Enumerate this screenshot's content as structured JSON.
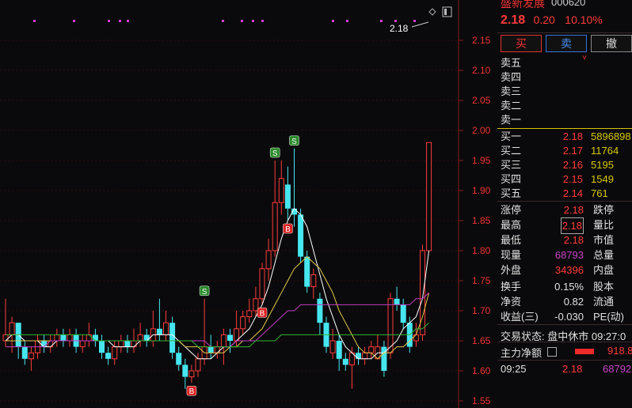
{
  "quote": {
    "name": "盛新发展",
    "code": "000620",
    "last_price": "2.18",
    "change": "0.20",
    "change_pct": "10.10%"
  },
  "actions": {
    "buy": "买",
    "sell": "卖",
    "cancel": "撤"
  },
  "order_book": {
    "asks": [
      {
        "label": "卖五"
      },
      {
        "label": "卖四"
      },
      {
        "label": "卖三"
      },
      {
        "label": "卖二"
      },
      {
        "label": "卖一"
      }
    ],
    "bids": [
      {
        "label": "买一",
        "price": "2.18",
        "volume": "5896898"
      },
      {
        "label": "买二",
        "price": "2.17",
        "volume": "11764"
      },
      {
        "label": "买三",
        "price": "2.16",
        "volume": "5195"
      },
      {
        "label": "买四",
        "price": "2.15",
        "volume": "1549"
      },
      {
        "label": "买五",
        "price": "2.14",
        "volume": "761"
      }
    ]
  },
  "stats": [
    {
      "l1": "涨停",
      "v1": "2.18",
      "l2": "跌停",
      "c": "#ff3b3b",
      "boxed": false
    },
    {
      "l1": "最高",
      "v1": "2.18",
      "l2": "量比",
      "c": "#ff3b3b",
      "boxed": true
    },
    {
      "l1": "最低",
      "v1": "2.18",
      "l2": "市值",
      "c": "#ff3b3b",
      "boxed": false
    },
    {
      "l1": "现量",
      "v1": "68793",
      "l2": "总量",
      "c": "#c844c8",
      "boxed": false
    },
    {
      "l1": "外盘",
      "v1": "34396",
      "l2": "内盘",
      "c": "#ff3b3b",
      "boxed": false
    },
    {
      "l1": "换手",
      "v1": "0.15%",
      "l2": "股本",
      "c": "#e0e0e0",
      "boxed": false
    },
    {
      "l1": "净资",
      "v1": "0.82",
      "l2": "流通",
      "c": "#e0e0e0",
      "boxed": false
    },
    {
      "l1": "收益(三)",
      "v1": "-0.030",
      "l2": "PE(动)",
      "c": "#e0e0e0",
      "boxed": false
    }
  ],
  "trade_status": "交易状态: 盘中休市 09:27:0",
  "main_flow": {
    "label": "主力净额",
    "value": "918.8"
  },
  "ticks": [
    {
      "time": "09:25",
      "price": "2.18",
      "volume": "68792"
    }
  ],
  "colors": {
    "up": "#ff3b3b",
    "down": "#46e6f0",
    "ma1": "#ffffff",
    "ma2": "#e3c84a",
    "ma3": "#c23cc2",
    "ma4": "#32b432",
    "accent": "#d7c400"
  },
  "chart_data": {
    "type": "candlestick",
    "ylim": [
      1.55,
      2.2
    ],
    "y_ticks": [
      "2.15",
      "2.10",
      "2.05",
      "2.00",
      "1.95",
      "1.90",
      "1.85",
      "1.80",
      "1.75",
      "1.70",
      "1.65",
      "1.60",
      "1.55"
    ],
    "price_marker": "2.18",
    "candles": [
      [
        1.65,
        1.66,
        1.72,
        1.64
      ],
      [
        1.66,
        1.68,
        1.69,
        1.63
      ],
      [
        1.68,
        1.64,
        1.68,
        1.62
      ],
      [
        1.64,
        1.62,
        1.65,
        1.61
      ],
      [
        1.62,
        1.63,
        1.64,
        1.6
      ],
      [
        1.63,
        1.65,
        1.66,
        1.62
      ],
      [
        1.65,
        1.64,
        1.66,
        1.63
      ],
      [
        1.64,
        1.65,
        1.66,
        1.63
      ],
      [
        1.65,
        1.66,
        1.67,
        1.64
      ],
      [
        1.66,
        1.65,
        1.67,
        1.64
      ],
      [
        1.65,
        1.66,
        1.67,
        1.64
      ],
      [
        1.66,
        1.64,
        1.67,
        1.63
      ],
      [
        1.64,
        1.65,
        1.66,
        1.63
      ],
      [
        1.65,
        1.66,
        1.68,
        1.64
      ],
      [
        1.66,
        1.65,
        1.67,
        1.64
      ],
      [
        1.65,
        1.63,
        1.66,
        1.62
      ],
      [
        1.63,
        1.62,
        1.64,
        1.61
      ],
      [
        1.62,
        1.64,
        1.65,
        1.61
      ],
      [
        1.64,
        1.65,
        1.66,
        1.63
      ],
      [
        1.65,
        1.64,
        1.66,
        1.63
      ],
      [
        1.64,
        1.65,
        1.67,
        1.63
      ],
      [
        1.65,
        1.66,
        1.68,
        1.64
      ],
      [
        1.66,
        1.65,
        1.67,
        1.64
      ],
      [
        1.65,
        1.67,
        1.7,
        1.64
      ],
      [
        1.67,
        1.66,
        1.72,
        1.65
      ],
      [
        1.66,
        1.68,
        1.7,
        1.65
      ],
      [
        1.68,
        1.63,
        1.69,
        1.62
      ],
      [
        1.63,
        1.61,
        1.64,
        1.6
      ],
      [
        1.61,
        1.59,
        1.62,
        1.57
      ],
      [
        1.59,
        1.6,
        1.61,
        1.58
      ],
      [
        1.6,
        1.62,
        1.63,
        1.59
      ],
      [
        1.62,
        1.64,
        1.72,
        1.61
      ],
      [
        1.64,
        1.63,
        1.66,
        1.62
      ],
      [
        1.63,
        1.64,
        1.65,
        1.62
      ],
      [
        1.64,
        1.66,
        1.67,
        1.61
      ],
      [
        1.66,
        1.65,
        1.67,
        1.63
      ],
      [
        1.65,
        1.67,
        1.7,
        1.64
      ],
      [
        1.67,
        1.69,
        1.7,
        1.66
      ],
      [
        1.69,
        1.7,
        1.72,
        1.68
      ],
      [
        1.7,
        1.72,
        1.74,
        1.69
      ],
      [
        1.72,
        1.77,
        1.78,
        1.71
      ],
      [
        1.77,
        1.8,
        1.82,
        1.75
      ],
      [
        1.8,
        1.88,
        1.95,
        1.79
      ],
      [
        1.88,
        1.92,
        1.95,
        1.86
      ],
      [
        1.91,
        1.87,
        1.94,
        1.85
      ],
      [
        1.87,
        1.86,
        1.97,
        1.84
      ],
      [
        1.86,
        1.79,
        1.87,
        1.78
      ],
      [
        1.79,
        1.74,
        1.8,
        1.73
      ],
      [
        1.74,
        1.76,
        1.77,
        1.72
      ],
      [
        1.72,
        1.68,
        1.73,
        1.66
      ],
      [
        1.68,
        1.64,
        1.69,
        1.63
      ],
      [
        1.63,
        1.65,
        1.67,
        1.62
      ],
      [
        1.65,
        1.62,
        1.66,
        1.6
      ],
      [
        1.62,
        1.61,
        1.63,
        1.6
      ],
      [
        1.61,
        1.63,
        1.64,
        1.57
      ],
      [
        1.63,
        1.62,
        1.64,
        1.61
      ],
      [
        1.62,
        1.63,
        1.64,
        1.61
      ],
      [
        1.63,
        1.64,
        1.65,
        1.62
      ],
      [
        1.62,
        1.64,
        1.66,
        1.62
      ],
      [
        1.64,
        1.6,
        1.65,
        1.59
      ],
      [
        1.63,
        1.72,
        1.73,
        1.62
      ],
      [
        1.72,
        1.71,
        1.74,
        1.7
      ],
      [
        1.71,
        1.68,
        1.72,
        1.67
      ],
      [
        1.68,
        1.64,
        1.69,
        1.63
      ],
      [
        1.65,
        1.66,
        1.68,
        1.64
      ],
      [
        1.66,
        1.8,
        1.81,
        1.65
      ],
      [
        1.8,
        1.98,
        1.98,
        1.8
      ]
    ],
    "ma_lines": [
      {
        "name": "MA5",
        "color": "#ffffff",
        "values": [
          1.65,
          1.66,
          1.66,
          1.65,
          1.65,
          1.65,
          1.64,
          1.64,
          1.65,
          1.65,
          1.65,
          1.65,
          1.65,
          1.65,
          1.65,
          1.65,
          1.65,
          1.64,
          1.64,
          1.64,
          1.64,
          1.65,
          1.65,
          1.66,
          1.66,
          1.66,
          1.66,
          1.65,
          1.64,
          1.63,
          1.62,
          1.62,
          1.62,
          1.63,
          1.64,
          1.64,
          1.65,
          1.66,
          1.67,
          1.69,
          1.71,
          1.74,
          1.78,
          1.82,
          1.85,
          1.87,
          1.86,
          1.84,
          1.8,
          1.76,
          1.72,
          1.69,
          1.66,
          1.64,
          1.63,
          1.62,
          1.62,
          1.62,
          1.63,
          1.63,
          1.64,
          1.65,
          1.67,
          1.68,
          1.69,
          1.72,
          1.8
        ]
      },
      {
        "name": "MA10",
        "color": "#e3c84a",
        "values": [
          1.65,
          1.65,
          1.65,
          1.65,
          1.65,
          1.65,
          1.65,
          1.65,
          1.65,
          1.65,
          1.65,
          1.65,
          1.65,
          1.65,
          1.65,
          1.65,
          1.65,
          1.65,
          1.65,
          1.65,
          1.65,
          1.65,
          1.65,
          1.65,
          1.65,
          1.65,
          1.65,
          1.65,
          1.64,
          1.64,
          1.64,
          1.63,
          1.63,
          1.63,
          1.63,
          1.64,
          1.64,
          1.65,
          1.65,
          1.66,
          1.67,
          1.69,
          1.71,
          1.73,
          1.75,
          1.77,
          1.78,
          1.79,
          1.78,
          1.77,
          1.75,
          1.73,
          1.7,
          1.68,
          1.66,
          1.64,
          1.63,
          1.63,
          1.62,
          1.63,
          1.63,
          1.64,
          1.64,
          1.65,
          1.66,
          1.69,
          1.73
        ]
      },
      {
        "name": "MA20",
        "color": "#c23cc2",
        "values": [
          1.64,
          1.64,
          1.64,
          1.64,
          1.64,
          1.64,
          1.64,
          1.65,
          1.65,
          1.65,
          1.65,
          1.65,
          1.65,
          1.65,
          1.65,
          1.65,
          1.65,
          1.65,
          1.65,
          1.65,
          1.65,
          1.65,
          1.65,
          1.65,
          1.65,
          1.65,
          1.65,
          1.65,
          1.65,
          1.65,
          1.65,
          1.65,
          1.64,
          1.64,
          1.64,
          1.64,
          1.65,
          1.65,
          1.65,
          1.65,
          1.66,
          1.67,
          1.68,
          1.69,
          1.7,
          1.7,
          1.71,
          1.71,
          1.71,
          1.71,
          1.71,
          1.71,
          1.71,
          1.71,
          1.71,
          1.71,
          1.71,
          1.71,
          1.71,
          1.71,
          1.71,
          1.71,
          1.71,
          1.71,
          1.72,
          1.72,
          1.73
        ]
      },
      {
        "name": "MA60",
        "color": "#32b432",
        "values": [
          1.66,
          1.66,
          1.66,
          1.66,
          1.66,
          1.66,
          1.66,
          1.66,
          1.66,
          1.66,
          1.66,
          1.66,
          1.66,
          1.66,
          1.65,
          1.65,
          1.65,
          1.65,
          1.65,
          1.65,
          1.65,
          1.65,
          1.65,
          1.65,
          1.65,
          1.65,
          1.65,
          1.65,
          1.65,
          1.65,
          1.64,
          1.64,
          1.64,
          1.64,
          1.64,
          1.64,
          1.64,
          1.64,
          1.64,
          1.65,
          1.65,
          1.65,
          1.65,
          1.66,
          1.66,
          1.66,
          1.66,
          1.66,
          1.66,
          1.66,
          1.66,
          1.66,
          1.66,
          1.66,
          1.66,
          1.66,
          1.66,
          1.66,
          1.66,
          1.66,
          1.66,
          1.66,
          1.66,
          1.66,
          1.67,
          1.67,
          1.68
        ]
      }
    ],
    "signals": [
      {
        "i": 29,
        "text": "B",
        "at": "low"
      },
      {
        "i": 31,
        "text": "S",
        "at": "high"
      },
      {
        "i": 40,
        "text": "B",
        "at": "low"
      },
      {
        "i": 42,
        "text": "S",
        "at": "high"
      },
      {
        "i": 44,
        "text": "B",
        "at": "low"
      },
      {
        "i": 45,
        "text": "S",
        "at": "high"
      }
    ]
  }
}
